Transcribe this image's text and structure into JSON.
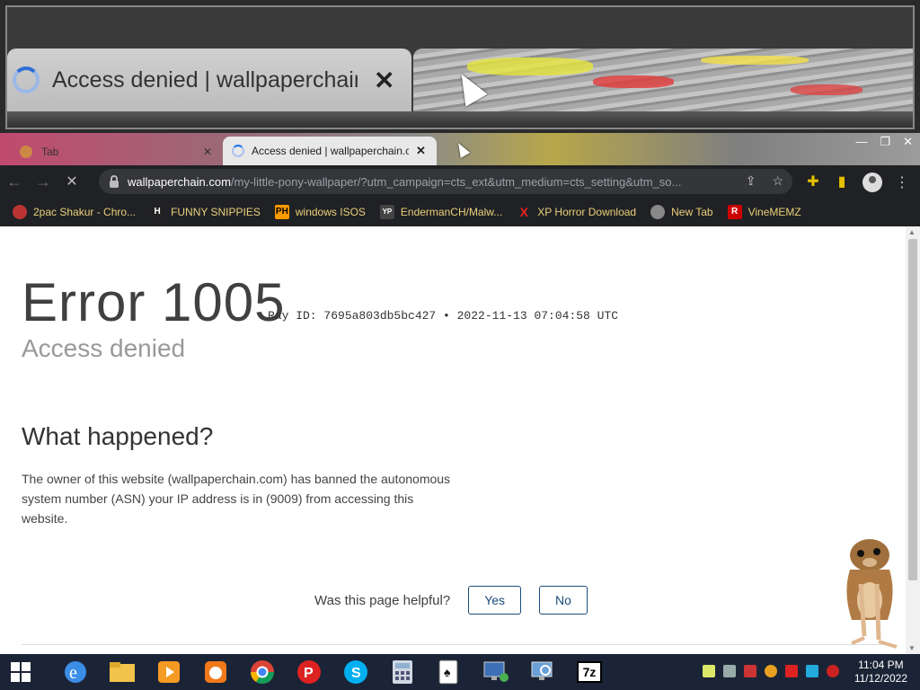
{
  "magnifier": {
    "tab_title": "Access denied | wallpaperchain.c",
    "close_glyph": "✕"
  },
  "browser": {
    "inactive_tab": {
      "label": "Tab",
      "close": "✕"
    },
    "active_tab": {
      "label": "Access denied | wallpaperchain.c",
      "close": "✕"
    },
    "window_controls": [
      "—",
      "❐",
      "✕"
    ],
    "url_host": "wallpaperchain.com",
    "url_path": "/my-little-pony-wallpaper/?utm_campaign=cts_ext&utm_medium=cts_setting&utm_so...",
    "bookmarks": [
      {
        "label": "2pac Shakur - Chro...",
        "icon_color": "#b33"
      },
      {
        "label": "FUNNY SNIPPIES",
        "icon_text": "H",
        "icon_color": "#222"
      },
      {
        "label": "windows ISOS",
        "icon_text": "PH",
        "icon_color": "#f90"
      },
      {
        "label": "EndermanCH/Malw...",
        "icon_text": "YP",
        "icon_color": "#444"
      },
      {
        "label": "XP Horror Download",
        "icon_text": "X",
        "icon_color": "#d00"
      },
      {
        "label": "New Tab",
        "icon_color": "#888"
      },
      {
        "label": "VineMEMZ",
        "icon_text": "R",
        "icon_color": "#c00"
      }
    ]
  },
  "page": {
    "error_code": "Error 1005",
    "ray_id": "Ray ID: 7695a803db5bc427 • 2022-11-13 07:04:58 UTC",
    "subtitle": "Access denied",
    "what_happened": "What happened?",
    "description": "The owner of this website (wallpaperchain.com) has banned the autonomous system number (ASN) your IP address is in (9009) from accessing this website.",
    "helpful_question": "Was this page helpful?",
    "yes_label": "Yes",
    "no_label": "No"
  },
  "taskbar": {
    "apps": [
      "internet-explorer",
      "file-explorer",
      "media-player",
      "uc-browser",
      "chrome",
      "pinball",
      "skype",
      "calculator",
      "solitaire",
      "remote-desktop",
      "network-monitor",
      "7zip"
    ],
    "time": "11:04 PM",
    "date": "11/12/2022",
    "sevenzip_label": "7z"
  }
}
